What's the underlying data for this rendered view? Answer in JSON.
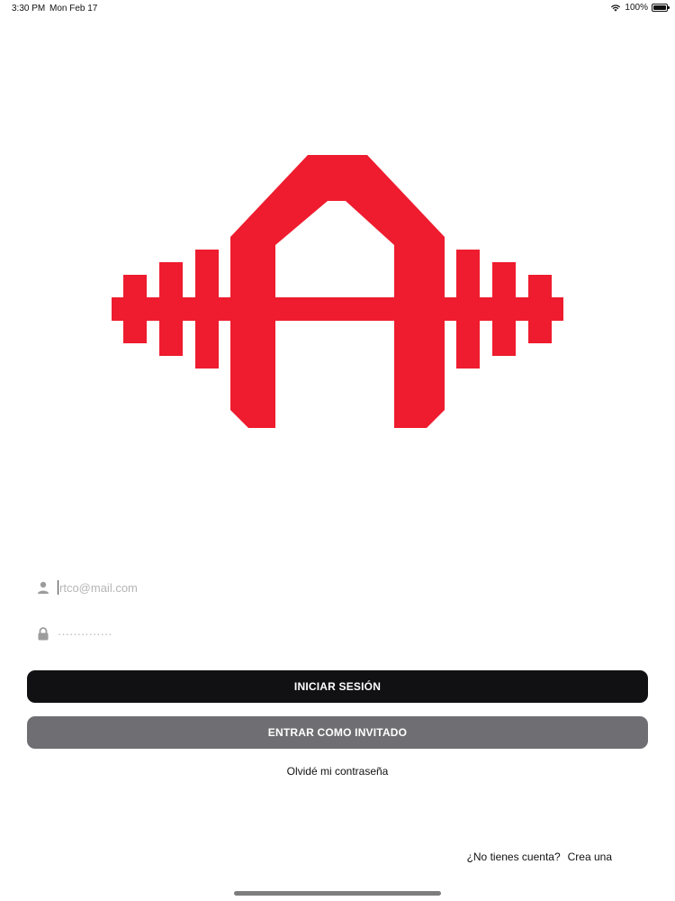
{
  "status_bar": {
    "time": "3:30 PM",
    "date": "Mon Feb 17",
    "battery": "100%",
    "battery_level": 1.0,
    "wifi_icon": "wifi-icon",
    "battery_icon": "battery-icon"
  },
  "logo": {
    "icon": "barbell-a-logo",
    "color": "#ee1c2e"
  },
  "login_form": {
    "email_placeholder": "rtco@mail.com",
    "email_value": "",
    "email_icon": "user-icon",
    "password_placeholder": "··············",
    "password_value": "",
    "password_icon": "lock-icon",
    "login_button": "INICIAR SESIÓN",
    "guest_button": "ENTRAR COMO INVITADO",
    "forgot_password": "Olvidé mi contraseña"
  },
  "footer": {
    "no_account": "¿No tienes cuenta?",
    "create_account": "Crea una"
  },
  "colors": {
    "login_button": "#111114",
    "guest_button": "#6f6e73",
    "brand_red": "#ee1c2e"
  }
}
